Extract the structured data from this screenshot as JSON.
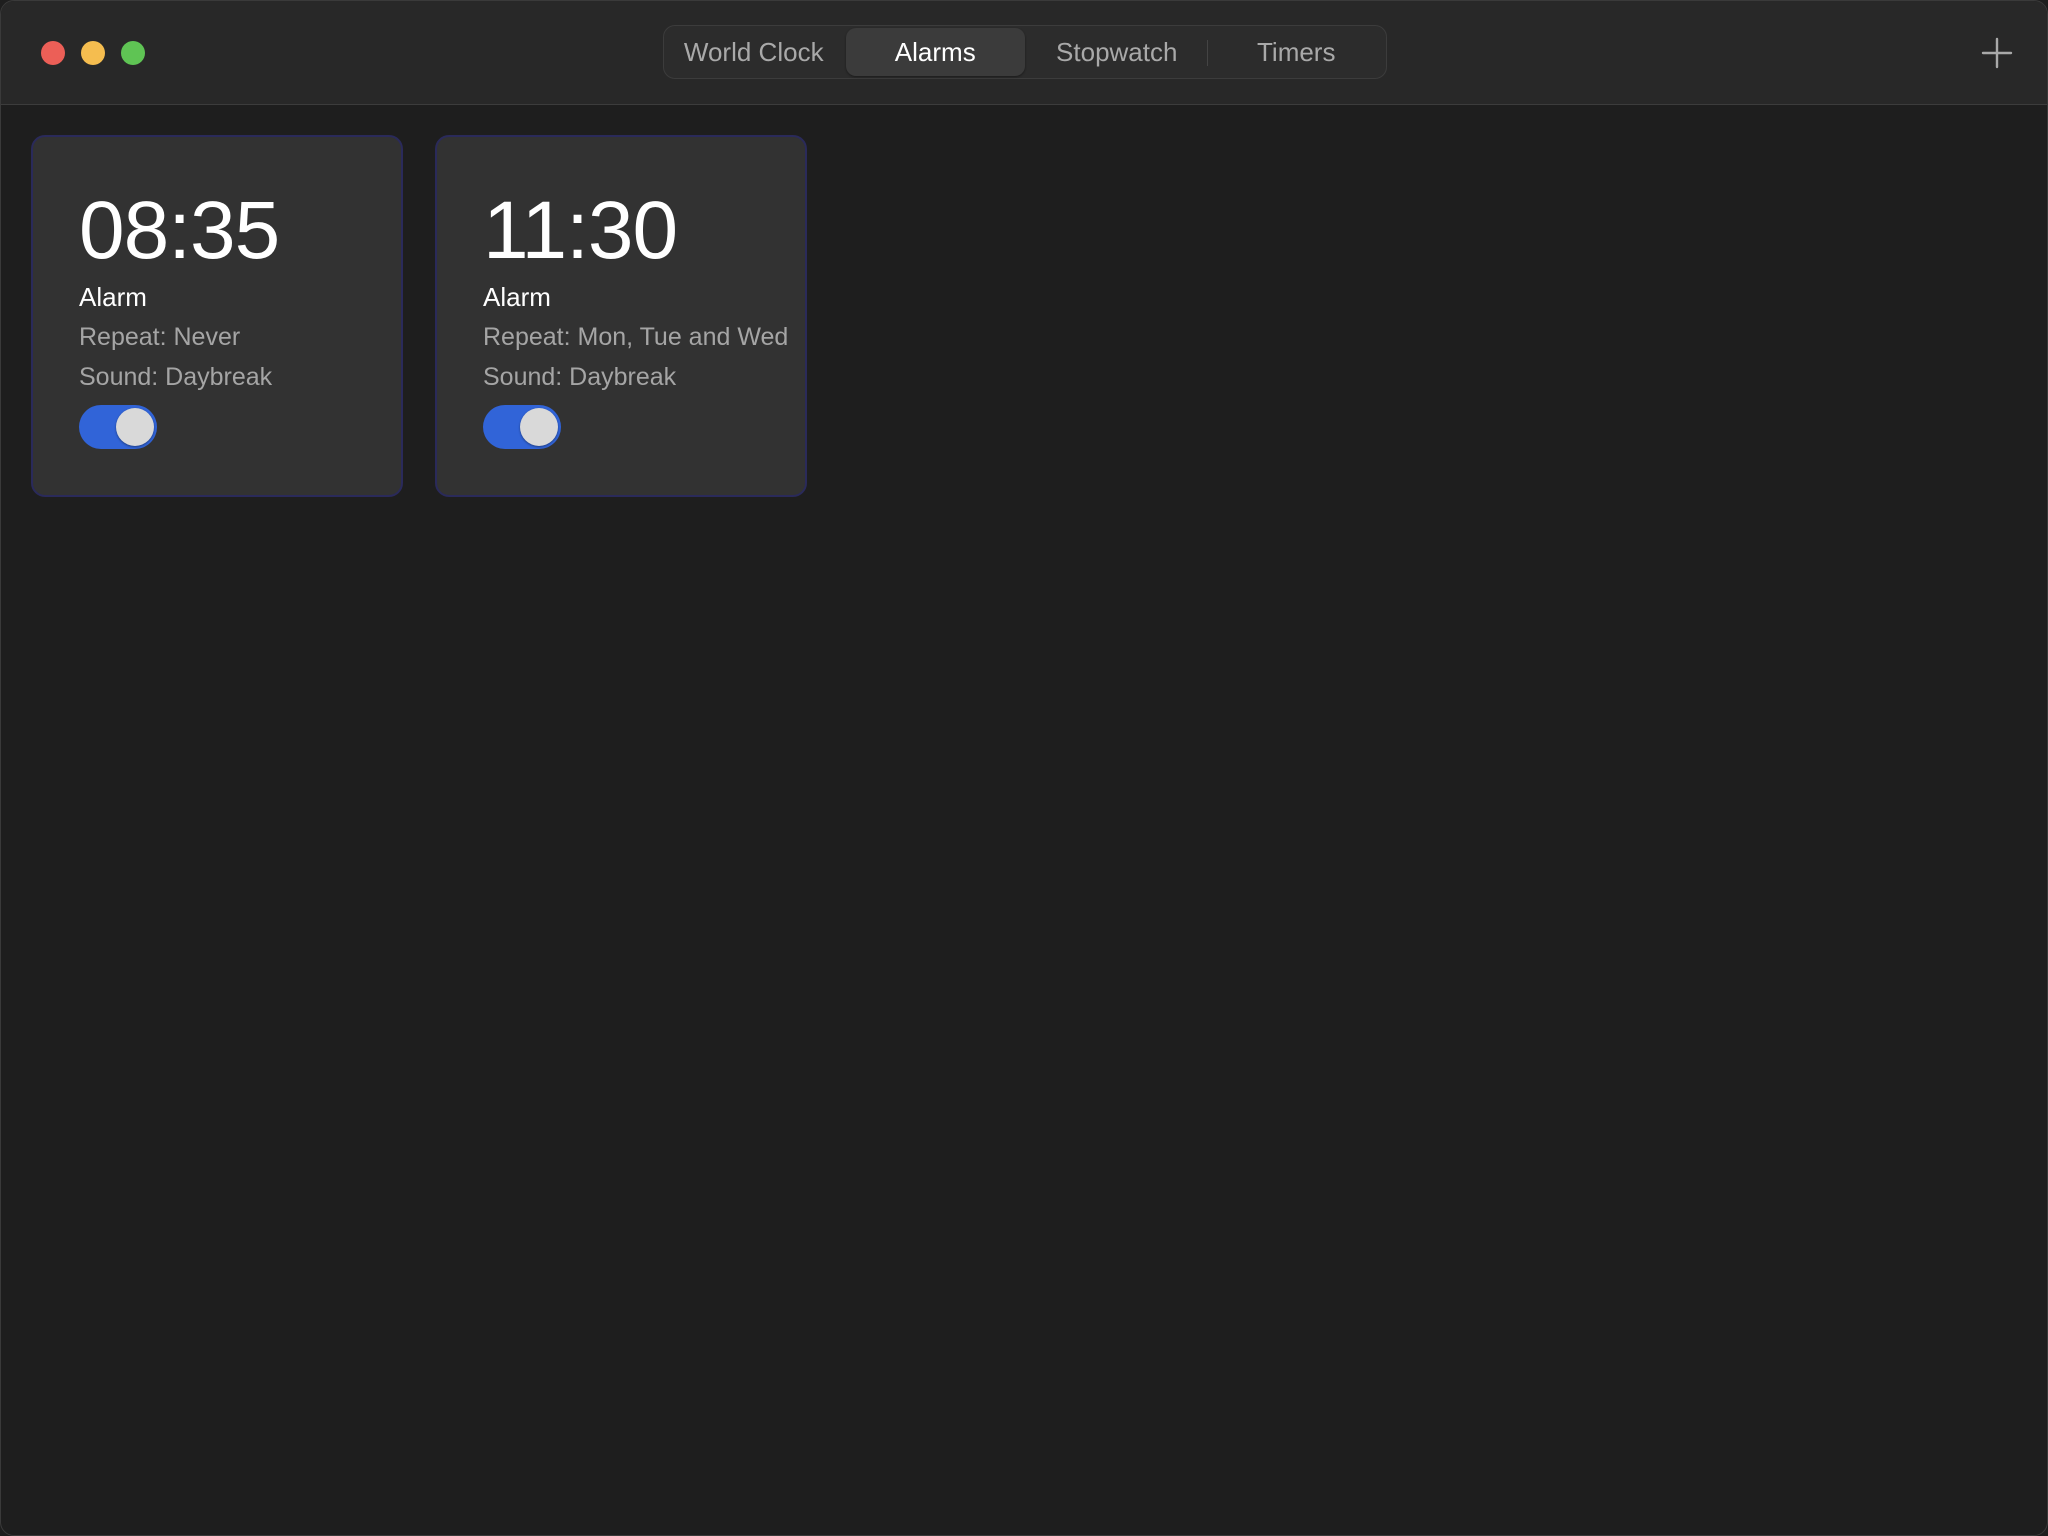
{
  "window": {
    "traffic_lights": {
      "close_color": "#ec5f57",
      "minimize_color": "#f5bd4f",
      "zoom_color": "#5fc454"
    }
  },
  "toolbar": {
    "tabs": [
      {
        "label": "World Clock",
        "selected": false
      },
      {
        "label": "Alarms",
        "selected": true
      },
      {
        "label": "Stopwatch",
        "selected": false
      },
      {
        "label": "Timers",
        "selected": false
      }
    ],
    "add_icon": "plus-icon"
  },
  "alarms": [
    {
      "time": "08:35",
      "label": "Alarm",
      "repeat": "Repeat: Never",
      "sound": "Sound: Daybreak",
      "enabled": true
    },
    {
      "time": "11:30",
      "label": "Alarm",
      "repeat": "Repeat: Mon, Tue and Wed",
      "sound": "Sound: Daybreak",
      "enabled": true
    }
  ],
  "colors": {
    "toggle_on": "#3164d8",
    "accent_text": "#ffffff",
    "secondary_text": "#a5a5a5"
  }
}
